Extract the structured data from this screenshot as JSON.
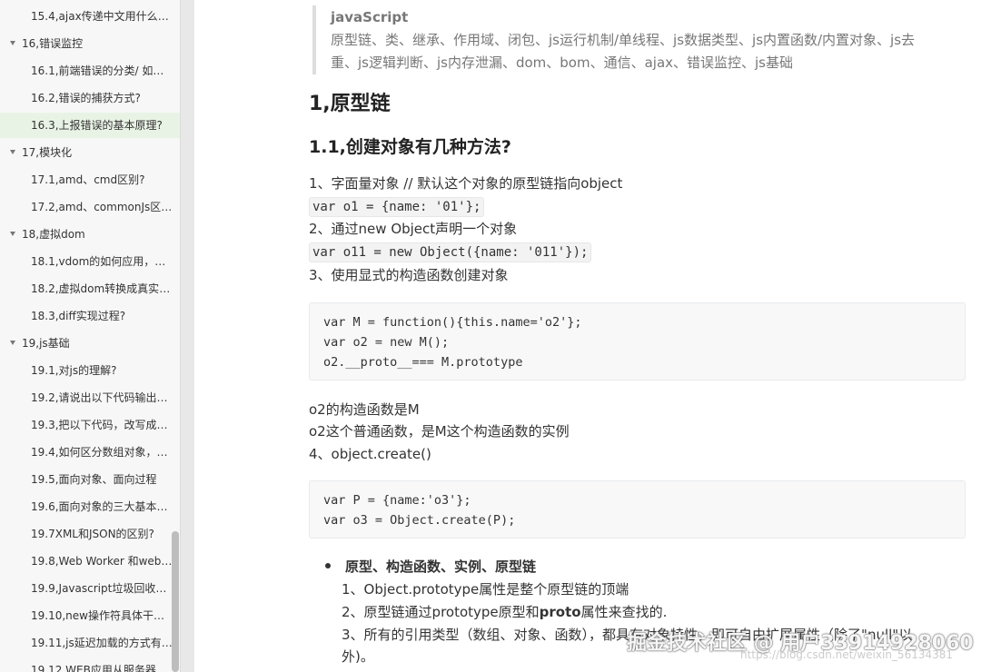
{
  "sidebar": {
    "items": [
      {
        "label": "15.4,ajax传递中文用什么方...",
        "level": 2,
        "active": false
      },
      {
        "label": "16,错误监控",
        "level": 1,
        "active": false
      },
      {
        "label": "16.1,前端错误的分类/ 如何...",
        "level": 2,
        "active": false
      },
      {
        "label": "16.2,错误的捕获方式?",
        "level": 2,
        "active": false
      },
      {
        "label": "16.3,上报错误的基本原理?",
        "level": 2,
        "active": true
      },
      {
        "label": "17,模块化",
        "level": 1,
        "active": false
      },
      {
        "label": "17.1,amd、cmd区别?",
        "level": 2,
        "active": false
      },
      {
        "label": "17.2,amd、commonJs区别...",
        "level": 2,
        "active": false
      },
      {
        "label": "18,虚拟dom",
        "level": 1,
        "active": false
      },
      {
        "label": "18.1,vdom的如何应用，核...",
        "level": 2,
        "active": false
      },
      {
        "label": "18.2,虚拟dom转换成真实d...",
        "level": 2,
        "active": false
      },
      {
        "label": "18.3,diff实现过程?",
        "level": 2,
        "active": false
      },
      {
        "label": "19,js基础",
        "level": 1,
        "active": false
      },
      {
        "label": "19.1,对js的理解?",
        "level": 2,
        "active": false
      },
      {
        "label": "19.2,请说出以下代码输出的...",
        "level": 2,
        "active": false
      },
      {
        "label": "19.3,把以下代码，改写成依...",
        "level": 2,
        "active": false
      },
      {
        "label": "19.4,如何区分数组对象，普...",
        "level": 2,
        "active": false
      },
      {
        "label": "19.5,面向对象、面向过程",
        "level": 2,
        "active": false
      },
      {
        "label": "19.6,面向对象的三大基本特性",
        "level": 2,
        "active": false
      },
      {
        "label": "19.7XML和JSON的区别?",
        "level": 2,
        "active": false
      },
      {
        "label": "19.8,Web Worker 和webS...",
        "level": 2,
        "active": false
      },
      {
        "label": "19.9,Javascript垃圾回收方...",
        "level": 2,
        "active": false
      },
      {
        "label": "19.10,new操作符具体干了...",
        "level": 2,
        "active": false
      },
      {
        "label": "19.11,js延迟加载的方式有哪...",
        "level": 2,
        "active": false
      },
      {
        "label": "19.12,WEB应用从服务器主...",
        "level": 2,
        "active": false
      }
    ]
  },
  "content": {
    "blockquote": {
      "title": "javaScript",
      "line1": "原型链、类、继承、作用域、闭包、js运行机制/单线程、js数据类型、js内置函数/内置对象、js去",
      "line2": "重、js逻辑判断、js内存泄漏、dom、bom、通信、ajax、错误监控、js基础"
    },
    "h1": "1,原型链",
    "h2": "1.1,创建对象有几种方法?",
    "p1": "1、字面量对象 // 默认这个对象的原型链指向object",
    "code1": "var o1 = {name: '01'};",
    "p2": "2、通过new Object声明一个对象",
    "code2": "var o11 = new Object({name: '011'});",
    "p3": "3、使用显式的构造函数创建对象",
    "block1": [
      "var M = function(){this.name='o2'};",
      "var o2 = new M();",
      "o2.__proto__=== M.prototype"
    ],
    "p4": "o2的构造函数是M",
    "p5": "o2这个普通函数，是M这个构造函数的实例",
    "p6": "4、object.create()",
    "block2": [
      "var P = {name:'o3'};",
      "var o3 = Object.create(P);"
    ],
    "bullet_title": "原型、构造函数、实例、原型链",
    "li1": "1、Object.prototype属性是整个原型链的顶端",
    "li2_pre": "2、原型链通过prototype原型和",
    "li2_bold": "proto",
    "li2_post": "属性来查找的.",
    "li3": "3、所有的引用类型（数组、对象、函数），都具有对象特性，即可自由扩展属性（除了\"null\"以",
    "li4": "外)。"
  },
  "watermark": {
    "main": "掘金技术社区 @ 用户3391492806​0",
    "sub": "https://blog.csdn.net/weixin_56134381"
  }
}
